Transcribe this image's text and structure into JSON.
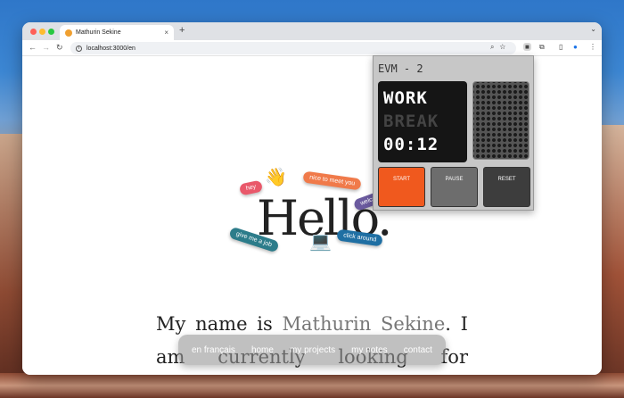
{
  "browser": {
    "tab_title": "Mathurin Sekine",
    "tab_close": "×",
    "new_tab": "+",
    "url": "localhost:3000/en"
  },
  "hero": {
    "title": "Hello.",
    "tags": {
      "hey": "hey",
      "nice": "nice to meet you",
      "welcome": "welco",
      "give": "give me a job",
      "click": "click around"
    }
  },
  "bio": {
    "text_before": "My name is ",
    "name": "Mathurin Sekine",
    "text_after": ". I am currently looking for opportunities in"
  },
  "bottom_nav": [
    "en français",
    "home",
    "my projects",
    "my notes",
    "contact"
  ],
  "timer": {
    "title": "EVM - 2",
    "mode_work": "WORK",
    "mode_break": "BREAK",
    "time": "00:12",
    "start": "START",
    "pause": "PAUSE",
    "reset": "RESET",
    "colors": {
      "start": "#f0591e",
      "pause": "#6d6d6d",
      "reset": "#3d3d3d"
    }
  }
}
